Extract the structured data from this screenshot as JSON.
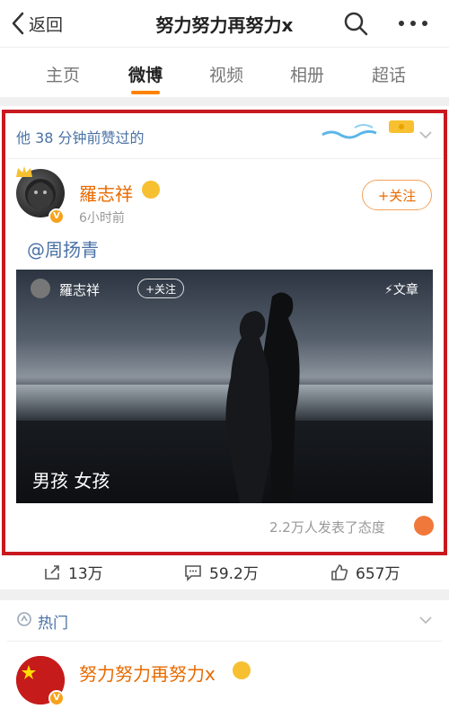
{
  "nav": {
    "back_label": "返回",
    "title": "努力努力再努力x",
    "search_icon": "search-icon",
    "more_icon": "more-dots-icon"
  },
  "tabs": [
    {
      "label": "主页",
      "active": false
    },
    {
      "label": "微博",
      "active": true
    },
    {
      "label": "视频",
      "active": false
    },
    {
      "label": "相册",
      "active": false
    },
    {
      "label": "超话",
      "active": false
    }
  ],
  "post": {
    "liked_hint": "他 38 分钟前赞过的",
    "author": "羅志祥",
    "time": "6小时前",
    "follow_label": "+关注",
    "mention": "@周扬青",
    "media": {
      "author": "羅志祥",
      "follow_label": "+关注",
      "article_label": "文章",
      "caption": "男孩 女孩"
    },
    "reactions_text": "2.2万人发表了态度",
    "actions": {
      "repost": "13万",
      "comment": "59.2万",
      "like": "657万"
    }
  },
  "hot": {
    "label": "热门",
    "author": "努力努力再努力x"
  },
  "colors": {
    "accent": "#ff8200",
    "author": "#e86a00",
    "link": "#4a72a6",
    "highlight_border": "#c8191f"
  }
}
